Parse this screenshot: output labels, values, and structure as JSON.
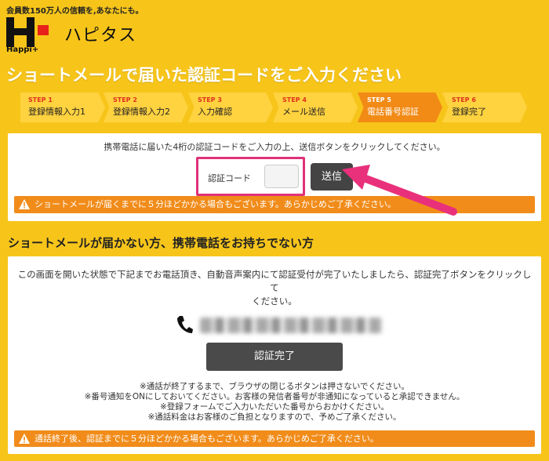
{
  "header": {
    "tagline": "会員数150万人の信頼を,あなたにも。",
    "brand_name": "ハピタス",
    "logo_sub": "Happi+",
    "logo_icon": "hapitas-logo-icon"
  },
  "page_title": "ショートメールで届いた認証コードをご入力ください",
  "steps": [
    {
      "num": "STEP 1",
      "label": "登録情報入力1",
      "active": false
    },
    {
      "num": "STEP 2",
      "label": "登録情報入力2",
      "active": false
    },
    {
      "num": "STEP 3",
      "label": "入力確認",
      "active": false
    },
    {
      "num": "STEP 4",
      "label": "メール送信",
      "active": false
    },
    {
      "num": "STEP 5",
      "label": "電話番号認証",
      "active": true
    },
    {
      "num": "STEP 6",
      "label": "登録完了",
      "active": false
    }
  ],
  "sms_panel": {
    "instruction": "携帯電話に届いた4桁の認証コードをご入力の上、送信ボタンをクリックしてください。",
    "code_label": "認証コード",
    "code_value": "",
    "send_label": "送信",
    "notice": "ショートメールが届くまでに５分ほどかかる場合もございます。あらかじめご了承ください。"
  },
  "call_section": {
    "title": "ショートメールが届かない方、携帯電話をお持ちでない方",
    "instruction_line1": "この画面を開いた状態で下記までお電話頂き、自動音声案内にて認証受付が完了いたしましたら、認証完了ボタンをクリックして",
    "instruction_line2": "ください。",
    "done_label": "認証完了",
    "notes": [
      "※通話が終了するまで、ブラウザの閉じるボタンは押さないでください。",
      "※番号通知をONにしておいてください。お客様の発信者番号が非通知になっていると承認できません。",
      "※登録フォームでご入力いただいた番号からおかけください。",
      "※通話料金はお客様のご負担となりますので、予めご了承ください。"
    ],
    "notice": "通話終了後、認証までに５分ほどかかる場合もございます。あらかじめご了承ください。"
  },
  "colors": {
    "background": "#f7c51a",
    "step_active": "#f28a16",
    "notice": "#f18c1a",
    "highlight": "#e0317a"
  }
}
